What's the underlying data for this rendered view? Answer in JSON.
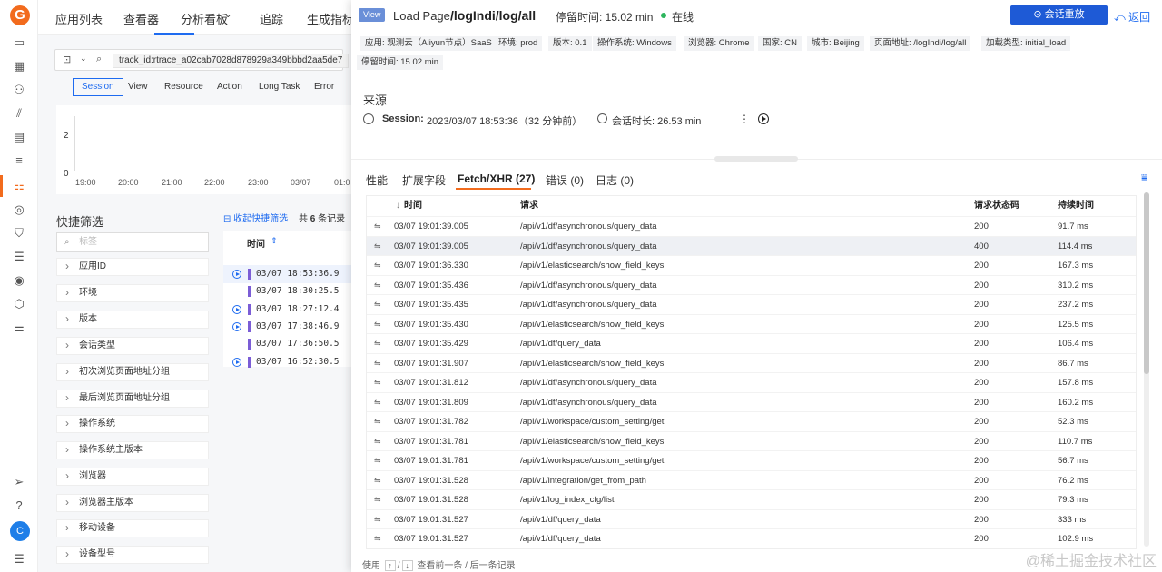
{
  "rail": {
    "logo": "G",
    "avatar": "C"
  },
  "topnav": {
    "items": [
      "应用列表",
      "查看器",
      "分析看板",
      "追踪",
      "生成指标"
    ]
  },
  "left": {
    "search_chip": "track_id:rtrace_a02cab7028d878929a349bbbd2aa5de7",
    "tabs": [
      "Session",
      "View",
      "Resource",
      "Action",
      "Long Task",
      "Error"
    ],
    "chart_data": {
      "type": "bar",
      "categories": [
        "19:00",
        "20:00",
        "21:00",
        "22:00",
        "23:00",
        "03/07",
        "01:0"
      ],
      "ytick": [
        "2",
        "0"
      ],
      "series": []
    },
    "quick_filter_title": "快捷筛选",
    "collapse_label": "收起快捷筛选",
    "total_prefix": "共",
    "total_count": "6",
    "total_suffix": "条记录",
    "filter_placeholder": "标签",
    "facets": [
      "应用ID",
      "环境",
      "版本",
      "会话类型",
      "初次浏览页面地址分组",
      "最后浏览页面地址分组",
      "操作系统",
      "操作系统主版本",
      "浏览器",
      "浏览器主版本",
      "移动设备",
      "设备型号"
    ],
    "list_header": "时间",
    "list_rows": [
      {
        "time": "03/07 18:53:36.9",
        "play": true
      },
      {
        "time": "03/07 18:30:25.5",
        "play": false
      },
      {
        "time": "03/07 18:27:12.4",
        "play": true
      },
      {
        "time": "03/07 17:38:46.9",
        "play": true
      },
      {
        "time": "03/07 17:36:50.5",
        "play": false
      },
      {
        "time": "03/07 16:52:30.5",
        "play": true
      }
    ]
  },
  "drawer": {
    "view_tag": "View",
    "title": "Load Page",
    "path": "/logIndi/log/all",
    "stay": "停留时间: 15.02 min",
    "status": "在线",
    "replay_button": "会话重放",
    "back_button": "返回",
    "tags": [
      "应用: 观测云（Aliyun节点）SaaS",
      "环境: prod",
      "版本: 0.1",
      "操作系统: Windows",
      "浏览器: Chrome",
      "国家: CN",
      "城市: Beijing",
      "页面地址: /logIndi/log/all",
      "加载类型: initial_load",
      "停留时间: 15.02 min"
    ],
    "source_title": "来源",
    "session_label": "Session:",
    "session_time": "2023/03/07 18:53:36（32 分钟前）",
    "session_duration": "会话时长: 26.53 min",
    "tabs": [
      "性能",
      "扩展字段",
      "Fetch/XHR (27)",
      "错误 (0)",
      "日志 (0)"
    ],
    "columns": [
      "时间",
      "请求",
      "请求状态码",
      "持续时间"
    ],
    "rows": [
      [
        "03/07 19:01:39.005",
        "/api/v1/df/asynchronous/query_data",
        "200",
        "91.7 ms"
      ],
      [
        "03/07 19:01:39.005",
        "/api/v1/df/asynchronous/query_data",
        "400",
        "114.4 ms"
      ],
      [
        "03/07 19:01:36.330",
        "/api/v1/elasticsearch/show_field_keys",
        "200",
        "167.3 ms"
      ],
      [
        "03/07 19:01:35.436",
        "/api/v1/df/asynchronous/query_data",
        "200",
        "310.2 ms"
      ],
      [
        "03/07 19:01:35.435",
        "/api/v1/df/asynchronous/query_data",
        "200",
        "237.2 ms"
      ],
      [
        "03/07 19:01:35.430",
        "/api/v1/elasticsearch/show_field_keys",
        "200",
        "125.5 ms"
      ],
      [
        "03/07 19:01:35.429",
        "/api/v1/df/query_data",
        "200",
        "106.4 ms"
      ],
      [
        "03/07 19:01:31.907",
        "/api/v1/elasticsearch/show_field_keys",
        "200",
        "86.7 ms"
      ],
      [
        "03/07 19:01:31.812",
        "/api/v1/df/asynchronous/query_data",
        "200",
        "157.8 ms"
      ],
      [
        "03/07 19:01:31.809",
        "/api/v1/df/asynchronous/query_data",
        "200",
        "160.2 ms"
      ],
      [
        "03/07 19:01:31.782",
        "/api/v1/workspace/custom_setting/get",
        "200",
        "52.3 ms"
      ],
      [
        "03/07 19:01:31.781",
        "/api/v1/elasticsearch/show_field_keys",
        "200",
        "110.7 ms"
      ],
      [
        "03/07 19:01:31.781",
        "/api/v1/workspace/custom_setting/get",
        "200",
        "56.7 ms"
      ],
      [
        "03/07 19:01:31.528",
        "/api/v1/integration/get_from_path",
        "200",
        "76.2 ms"
      ],
      [
        "03/07 19:01:31.528",
        "/api/v1/log_index_cfg/list",
        "200",
        "79.3 ms"
      ],
      [
        "03/07 19:01:31.527",
        "/api/v1/df/query_data",
        "200",
        "333 ms"
      ],
      [
        "03/07 19:01:31.527",
        "/api/v1/df/query_data",
        "200",
        "102.9 ms"
      ]
    ],
    "footer": {
      "use": "使用",
      "up": "↑",
      "slash": "/",
      "down": "↓",
      "hint": "查看前一条 / 后一条记录"
    }
  },
  "watermark": "@稀土掘金技术社区"
}
